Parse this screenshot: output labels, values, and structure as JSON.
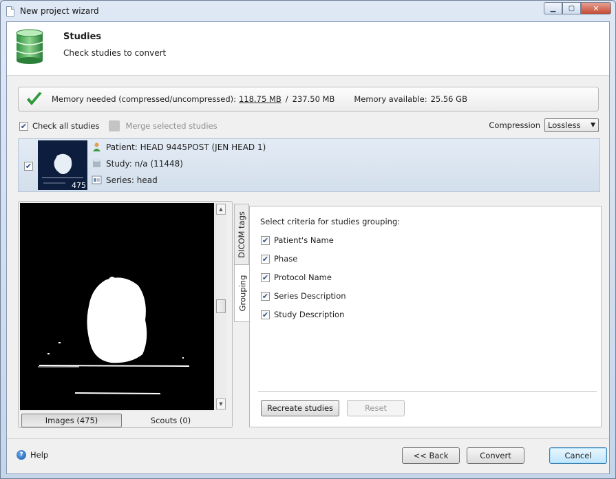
{
  "window": {
    "title": "New project wizard",
    "controls": {
      "minimize": "▁",
      "maximize": "▢",
      "close": "✕"
    }
  },
  "header": {
    "icon": "database-icon",
    "title": "Studies",
    "subtitle": "Check studies to convert"
  },
  "memory": {
    "icon": "checkmark-icon",
    "needed_label": "Memory needed (compressed/uncompressed):",
    "compressed": "118.75 MB",
    "separator": "/",
    "uncompressed": "237.50 MB",
    "available_label": "Memory available:",
    "available": "25.56 GB"
  },
  "toolbar": {
    "check_all_label": "Check all studies",
    "check_all_checked": true,
    "merge_label": "Merge selected studies",
    "compression_label": "Compression",
    "compression_value": "Lossless"
  },
  "study": {
    "checked": true,
    "thumb_count": "475",
    "patient": "Patient: HEAD 9445POST (JEN HEAD 1)",
    "study": "Study: n/a (11448)",
    "series": "Series: head"
  },
  "viewer": {
    "tabs": [
      "Images (475)",
      "Scouts (0)"
    ],
    "active_tab": "Images (475)"
  },
  "side_tabs": [
    "DICOM tags",
    "Grouping"
  ],
  "active_side_tab": "Grouping",
  "grouping": {
    "title": "Select criteria for studies grouping:",
    "criteria": [
      {
        "label": "Patient's Name",
        "checked": true
      },
      {
        "label": "Phase",
        "checked": true
      },
      {
        "label": "Protocol Name",
        "checked": true
      },
      {
        "label": "Series Description",
        "checked": true
      },
      {
        "label": "Study Description",
        "checked": true
      }
    ],
    "recreate_label": "Recreate studies",
    "reset_label": "Reset"
  },
  "footer": {
    "help_label": "Help",
    "back_label": "<< Back",
    "convert_label": "Convert",
    "cancel_label": "Cancel"
  },
  "colors": {
    "accent": "#3c7fb1",
    "check_green": "#2f9a3b",
    "selection_row": "#dbe5f1"
  }
}
